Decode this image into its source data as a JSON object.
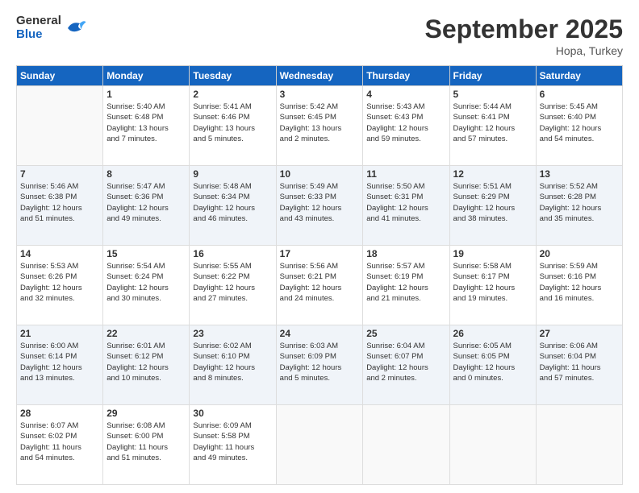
{
  "header": {
    "logo": {
      "general": "General",
      "blue": "Blue"
    },
    "title": "September 2025",
    "location": "Hopa, Turkey"
  },
  "weekdays": [
    "Sunday",
    "Monday",
    "Tuesday",
    "Wednesday",
    "Thursday",
    "Friday",
    "Saturday"
  ],
  "weeks": [
    [
      {
        "day": "",
        "info": ""
      },
      {
        "day": "1",
        "info": "Sunrise: 5:40 AM\nSunset: 6:48 PM\nDaylight: 13 hours\nand 7 minutes."
      },
      {
        "day": "2",
        "info": "Sunrise: 5:41 AM\nSunset: 6:46 PM\nDaylight: 13 hours\nand 5 minutes."
      },
      {
        "day": "3",
        "info": "Sunrise: 5:42 AM\nSunset: 6:45 PM\nDaylight: 13 hours\nand 2 minutes."
      },
      {
        "day": "4",
        "info": "Sunrise: 5:43 AM\nSunset: 6:43 PM\nDaylight: 12 hours\nand 59 minutes."
      },
      {
        "day": "5",
        "info": "Sunrise: 5:44 AM\nSunset: 6:41 PM\nDaylight: 12 hours\nand 57 minutes."
      },
      {
        "day": "6",
        "info": "Sunrise: 5:45 AM\nSunset: 6:40 PM\nDaylight: 12 hours\nand 54 minutes."
      }
    ],
    [
      {
        "day": "7",
        "info": "Sunrise: 5:46 AM\nSunset: 6:38 PM\nDaylight: 12 hours\nand 51 minutes."
      },
      {
        "day": "8",
        "info": "Sunrise: 5:47 AM\nSunset: 6:36 PM\nDaylight: 12 hours\nand 49 minutes."
      },
      {
        "day": "9",
        "info": "Sunrise: 5:48 AM\nSunset: 6:34 PM\nDaylight: 12 hours\nand 46 minutes."
      },
      {
        "day": "10",
        "info": "Sunrise: 5:49 AM\nSunset: 6:33 PM\nDaylight: 12 hours\nand 43 minutes."
      },
      {
        "day": "11",
        "info": "Sunrise: 5:50 AM\nSunset: 6:31 PM\nDaylight: 12 hours\nand 41 minutes."
      },
      {
        "day": "12",
        "info": "Sunrise: 5:51 AM\nSunset: 6:29 PM\nDaylight: 12 hours\nand 38 minutes."
      },
      {
        "day": "13",
        "info": "Sunrise: 5:52 AM\nSunset: 6:28 PM\nDaylight: 12 hours\nand 35 minutes."
      }
    ],
    [
      {
        "day": "14",
        "info": "Sunrise: 5:53 AM\nSunset: 6:26 PM\nDaylight: 12 hours\nand 32 minutes."
      },
      {
        "day": "15",
        "info": "Sunrise: 5:54 AM\nSunset: 6:24 PM\nDaylight: 12 hours\nand 30 minutes."
      },
      {
        "day": "16",
        "info": "Sunrise: 5:55 AM\nSunset: 6:22 PM\nDaylight: 12 hours\nand 27 minutes."
      },
      {
        "day": "17",
        "info": "Sunrise: 5:56 AM\nSunset: 6:21 PM\nDaylight: 12 hours\nand 24 minutes."
      },
      {
        "day": "18",
        "info": "Sunrise: 5:57 AM\nSunset: 6:19 PM\nDaylight: 12 hours\nand 21 minutes."
      },
      {
        "day": "19",
        "info": "Sunrise: 5:58 AM\nSunset: 6:17 PM\nDaylight: 12 hours\nand 19 minutes."
      },
      {
        "day": "20",
        "info": "Sunrise: 5:59 AM\nSunset: 6:16 PM\nDaylight: 12 hours\nand 16 minutes."
      }
    ],
    [
      {
        "day": "21",
        "info": "Sunrise: 6:00 AM\nSunset: 6:14 PM\nDaylight: 12 hours\nand 13 minutes."
      },
      {
        "day": "22",
        "info": "Sunrise: 6:01 AM\nSunset: 6:12 PM\nDaylight: 12 hours\nand 10 minutes."
      },
      {
        "day": "23",
        "info": "Sunrise: 6:02 AM\nSunset: 6:10 PM\nDaylight: 12 hours\nand 8 minutes."
      },
      {
        "day": "24",
        "info": "Sunrise: 6:03 AM\nSunset: 6:09 PM\nDaylight: 12 hours\nand 5 minutes."
      },
      {
        "day": "25",
        "info": "Sunrise: 6:04 AM\nSunset: 6:07 PM\nDaylight: 12 hours\nand 2 minutes."
      },
      {
        "day": "26",
        "info": "Sunrise: 6:05 AM\nSunset: 6:05 PM\nDaylight: 12 hours\nand 0 minutes."
      },
      {
        "day": "27",
        "info": "Sunrise: 6:06 AM\nSunset: 6:04 PM\nDaylight: 11 hours\nand 57 minutes."
      }
    ],
    [
      {
        "day": "28",
        "info": "Sunrise: 6:07 AM\nSunset: 6:02 PM\nDaylight: 11 hours\nand 54 minutes."
      },
      {
        "day": "29",
        "info": "Sunrise: 6:08 AM\nSunset: 6:00 PM\nDaylight: 11 hours\nand 51 minutes."
      },
      {
        "day": "30",
        "info": "Sunrise: 6:09 AM\nSunset: 5:58 PM\nDaylight: 11 hours\nand 49 minutes."
      },
      {
        "day": "",
        "info": ""
      },
      {
        "day": "",
        "info": ""
      },
      {
        "day": "",
        "info": ""
      },
      {
        "day": "",
        "info": ""
      }
    ]
  ]
}
